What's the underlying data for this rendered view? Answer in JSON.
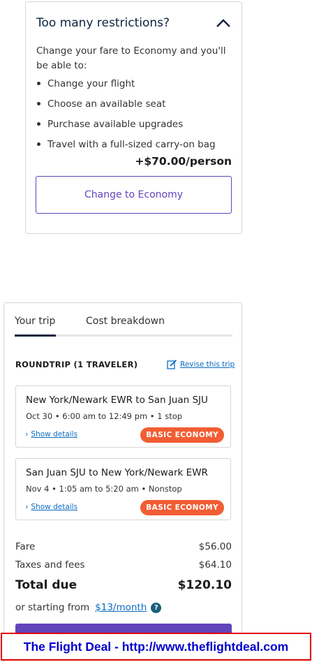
{
  "restrictions": {
    "title": "Too many restrictions?",
    "intro": "Change your fare to Economy and you'll be able to:",
    "benefits": [
      "Change your flight",
      "Choose an available seat",
      "Purchase available upgrades",
      "Travel with a full-sized carry-on bag"
    ],
    "price": "+$70.00/person",
    "button_label": "Change to Economy"
  },
  "trip": {
    "tabs": [
      "Your trip",
      "Cost breakdown"
    ],
    "active_tab": "Your trip",
    "summary_label": "ROUNDTRIP (1 TRAVELER)",
    "revise_label": "Revise this trip",
    "segments": [
      {
        "route": "New York/Newark EWR to San Juan SJU",
        "time": "Oct 30 • 6:00 am to 12:49 pm • 1 stop",
        "details_label": "Show details",
        "badge": "BASIC ECONOMY"
      },
      {
        "route": "San Juan SJU to New York/Newark EWR",
        "time": "Nov 4 • 1:05 am to 5:20 am • Nonstop",
        "details_label": "Show details",
        "badge": "BASIC ECONOMY"
      }
    ],
    "costs": {
      "fare_label": "Fare",
      "fare_value": "$56.00",
      "taxes_label": "Taxes and fees",
      "taxes_value": "$64.10",
      "total_label": "Total due",
      "total_value": "$120.10"
    },
    "financing": {
      "prefix": "or starting from",
      "link": "$13/month",
      "help": "?"
    }
  },
  "banner": {
    "text": "The Flight Deal - http://www.theflightdeal.com"
  },
  "colors": {
    "brand_purple": "#6244bb",
    "badge_orange": "#f25d33",
    "link_blue": "#0c6cc2",
    "navy": "#0c2340"
  }
}
